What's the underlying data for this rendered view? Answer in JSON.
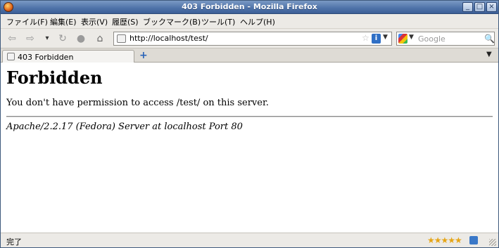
{
  "window": {
    "title": "403 Forbidden - Mozilla Firefox"
  },
  "menu": [
    "ファイル(F)",
    "編集(E)",
    "表示(V)",
    "履歴(S)",
    "ブックマーク(B)",
    "ツール(T)",
    "ヘルプ(H)"
  ],
  "navigation": {
    "url": "http://localhost/test/",
    "search_placeholder": "Google"
  },
  "tabs": [
    {
      "label": "403 Forbidden"
    }
  ],
  "page": {
    "heading": "Forbidden",
    "message": "You don't have permission to access /test/ on this server.",
    "server_signature": "Apache/2.2.17 (Fedora) Server at localhost Port 80"
  },
  "status": {
    "text": "完了"
  }
}
